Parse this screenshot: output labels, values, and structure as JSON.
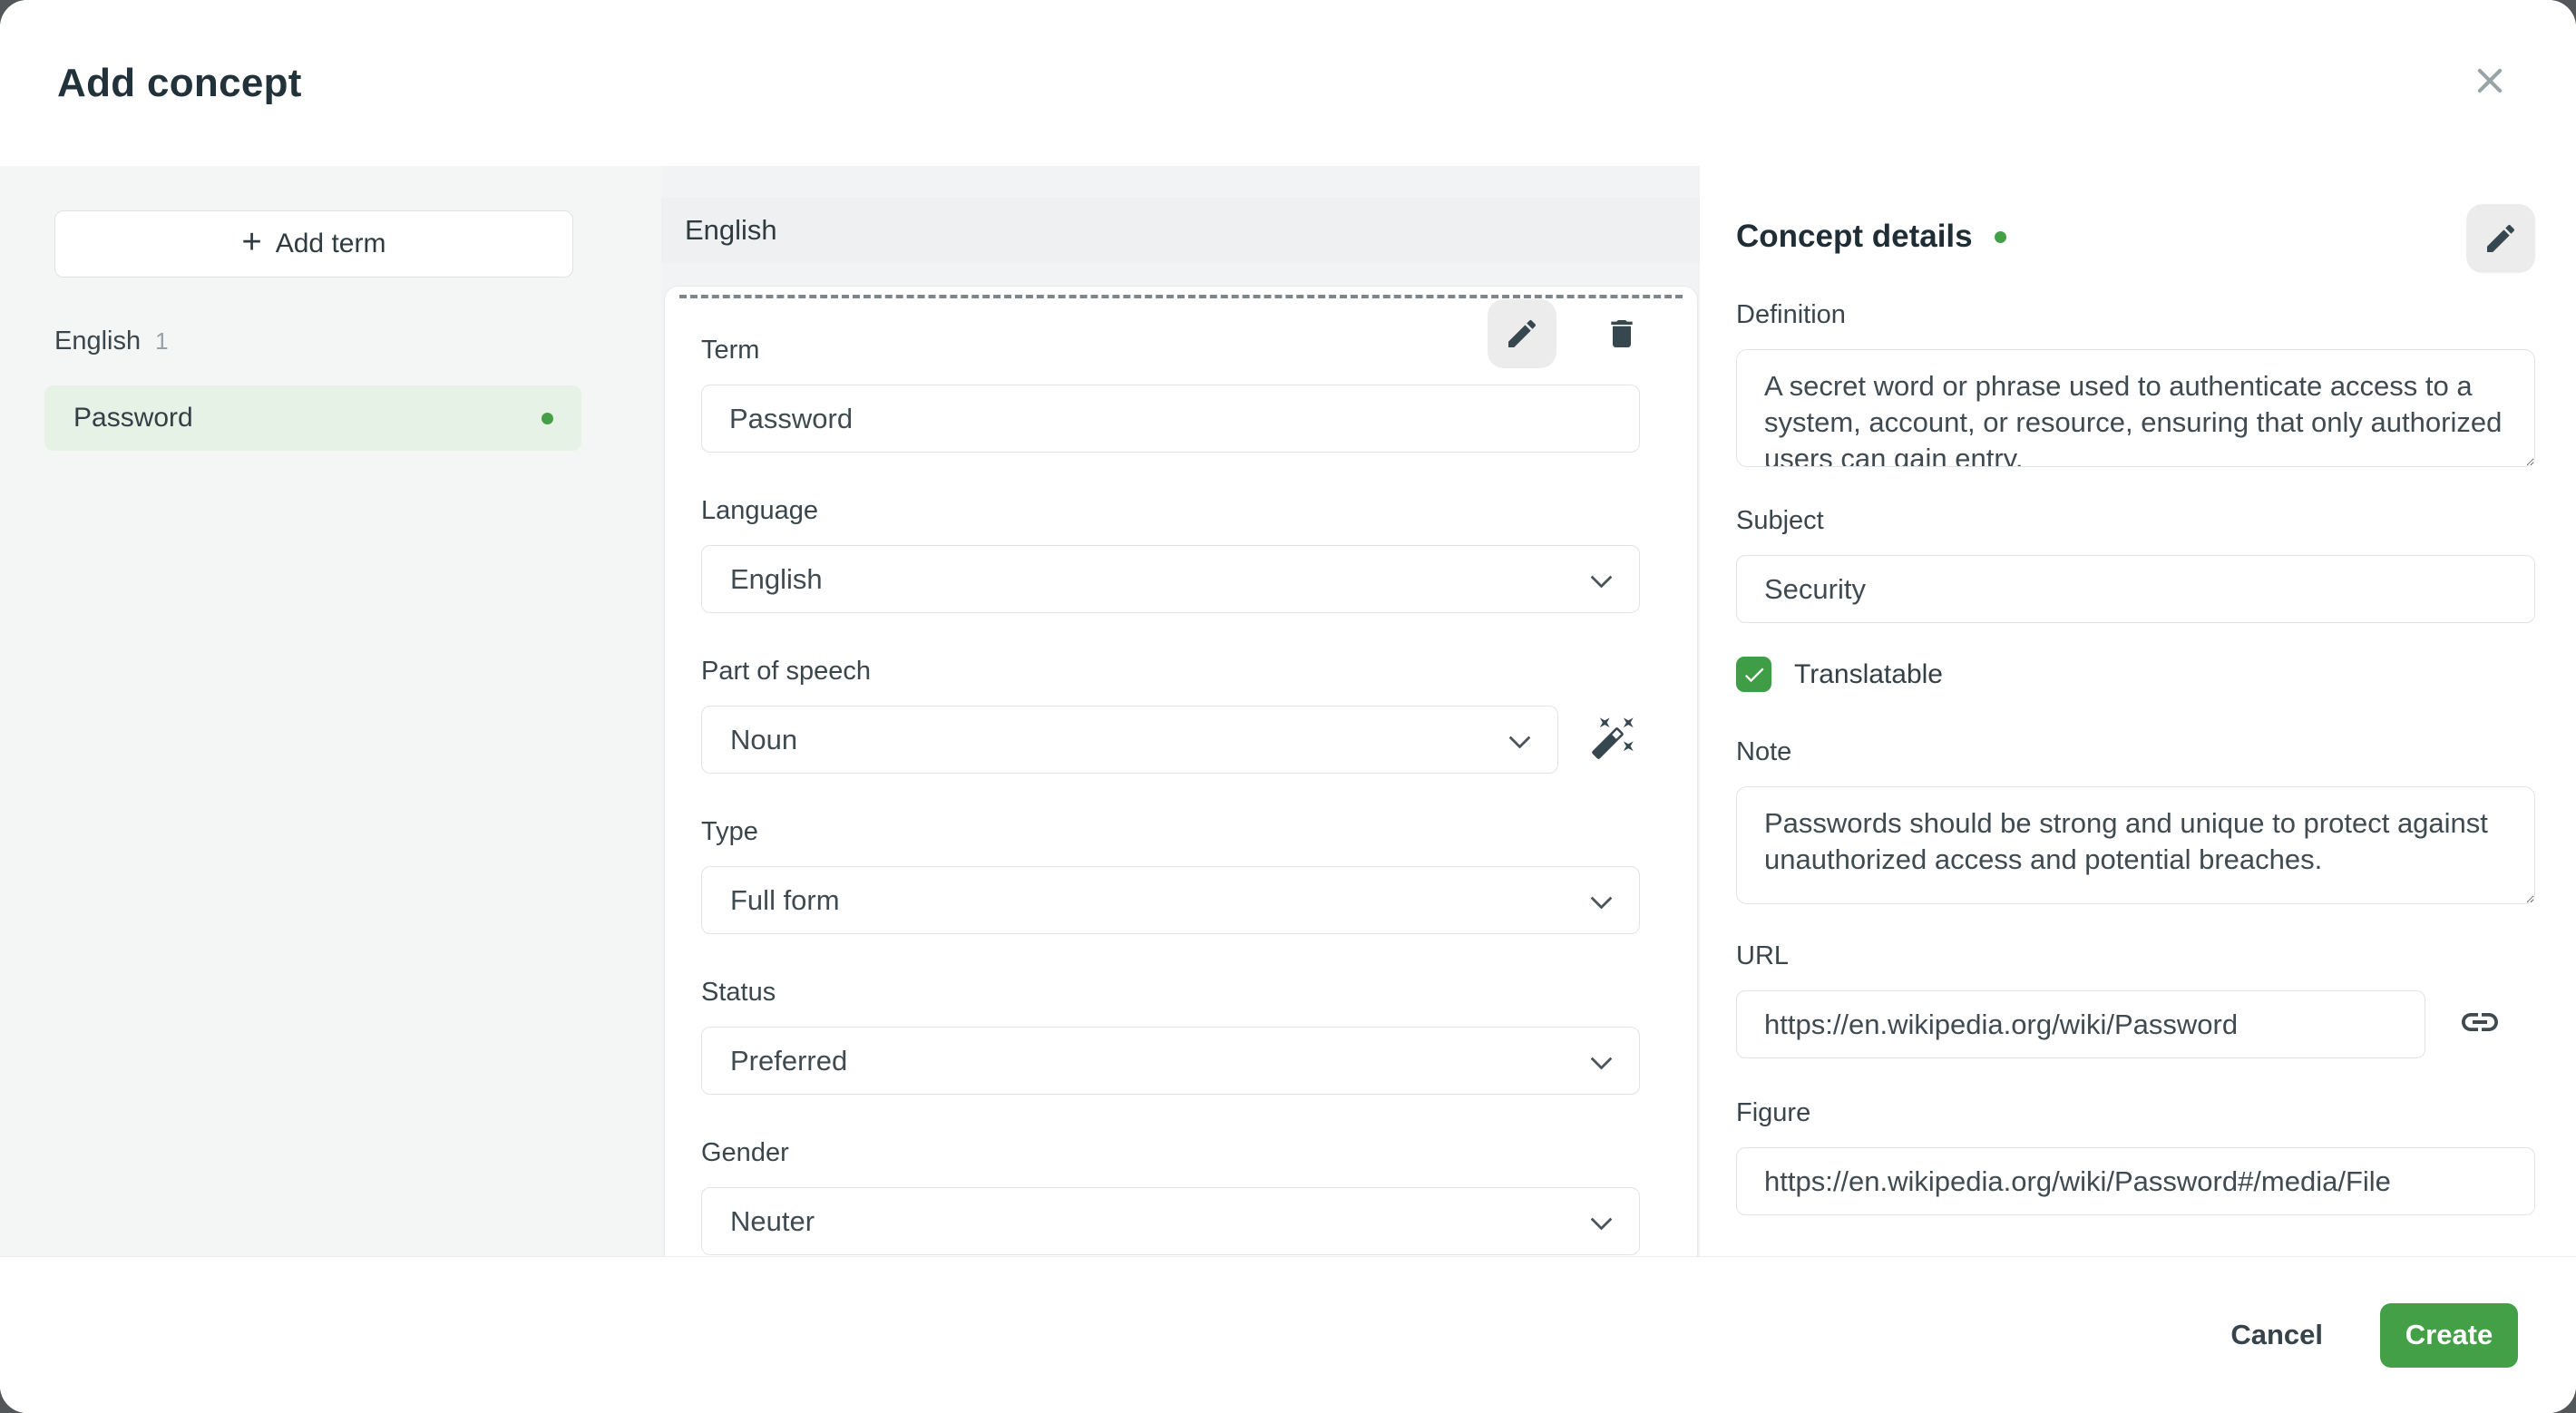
{
  "dialog": {
    "title": "Add concept"
  },
  "colors": {
    "accent_green": "#43a047",
    "term_item_bg": "#e7f2e7"
  },
  "sidebar": {
    "add_term_plus": "+",
    "add_term_label": "Add term",
    "language_group": {
      "label": "English",
      "count": "1"
    },
    "terms": [
      {
        "label": "Password"
      }
    ]
  },
  "term_editor": {
    "header": "English",
    "term": {
      "label": "Term",
      "value": "Password"
    },
    "language": {
      "label": "Language",
      "value": "English"
    },
    "part_of_speech": {
      "label": "Part of speech",
      "value": "Noun"
    },
    "type": {
      "label": "Type",
      "value": "Full form"
    },
    "status": {
      "label": "Status",
      "value": "Preferred"
    },
    "gender": {
      "label": "Gender",
      "value": "Neuter"
    }
  },
  "concept_details": {
    "title": "Concept details",
    "definition": {
      "label": "Definition",
      "value": "A secret word or phrase used to authenticate access to a system, account, or resource, ensuring that only authorized users can gain entry."
    },
    "subject": {
      "label": "Subject",
      "value": "Security"
    },
    "translatable": {
      "label": "Translatable",
      "checked": true
    },
    "note": {
      "label": "Note",
      "value": "Passwords should be strong and unique to protect against unauthorized access and potential breaches."
    },
    "url": {
      "label": "URL",
      "value": "https://en.wikipedia.org/wiki/Password"
    },
    "figure": {
      "label": "Figure",
      "value": "https://en.wikipedia.org/wiki/Password#/media/File"
    }
  },
  "footer": {
    "cancel": "Cancel",
    "create": "Create"
  }
}
